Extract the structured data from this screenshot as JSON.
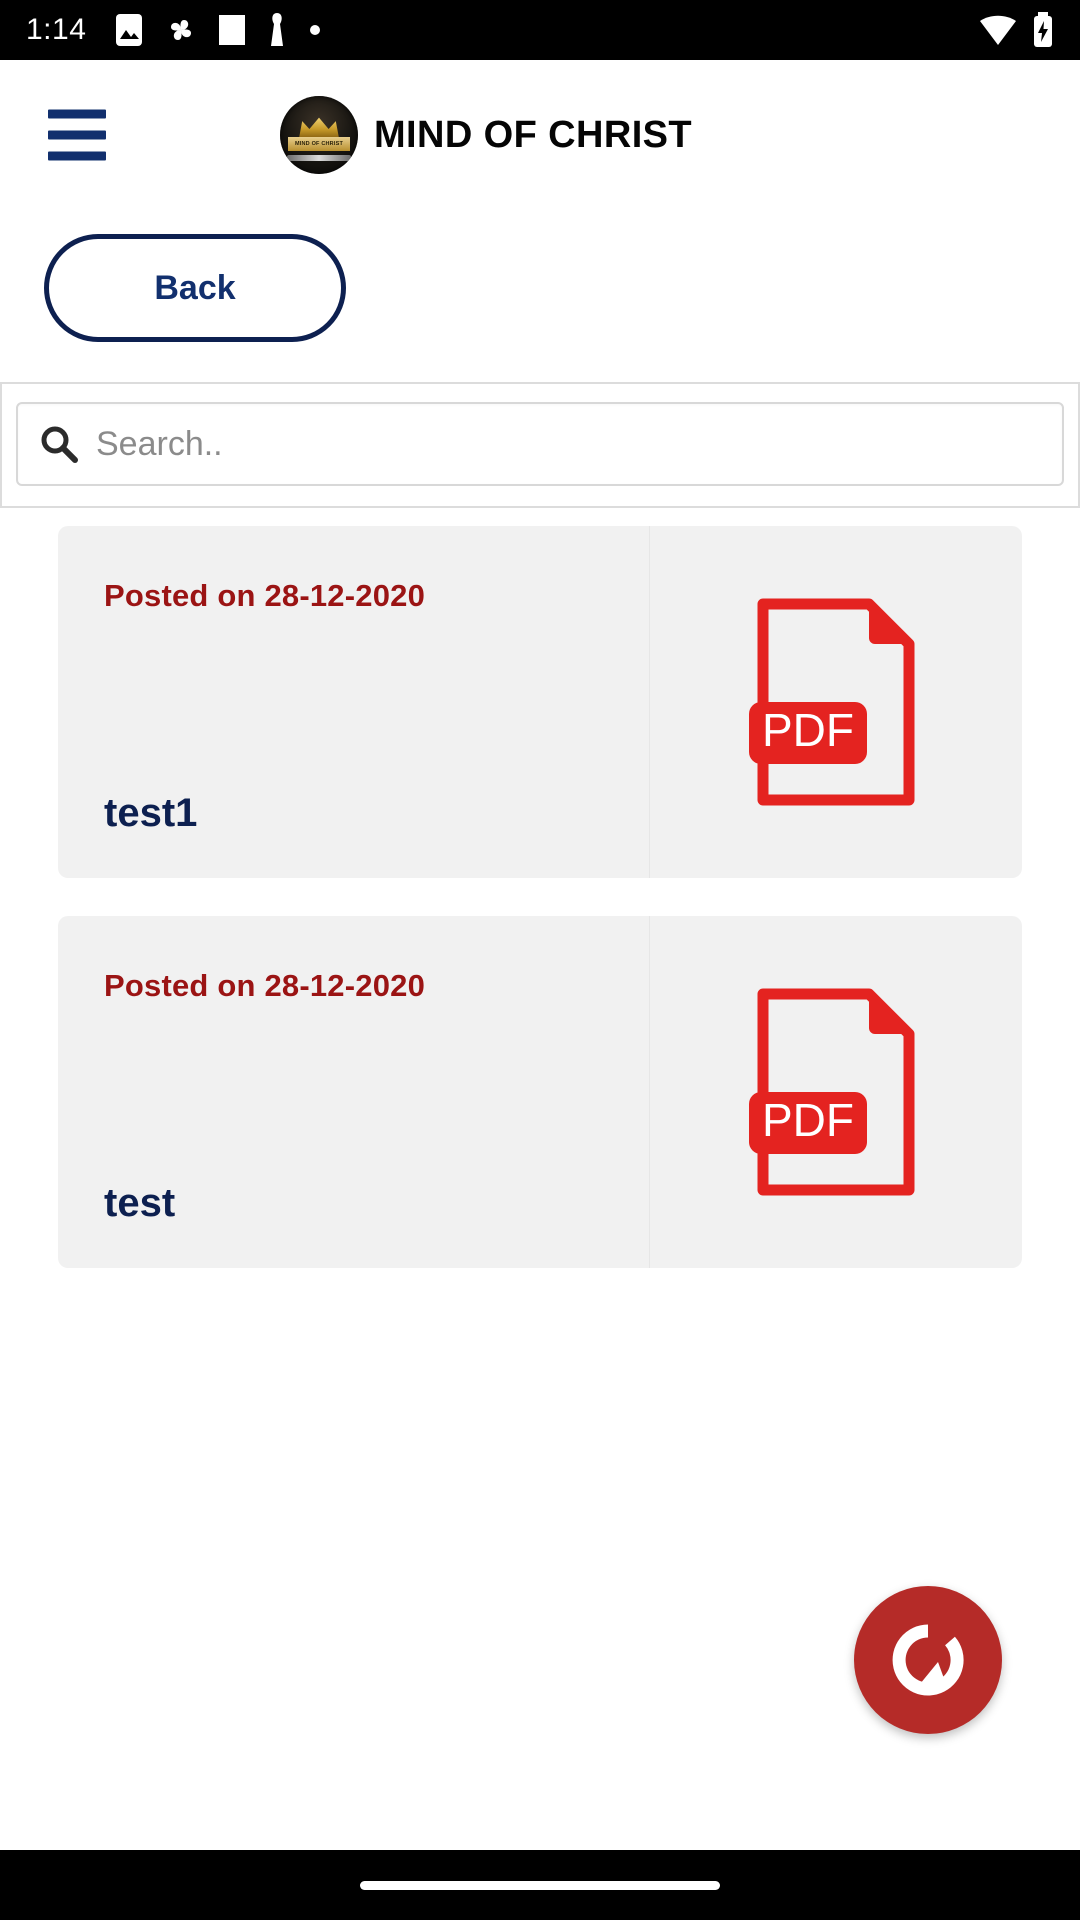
{
  "status_bar": {
    "time": "1:14",
    "left_icons": [
      "photo-icon",
      "pinwheel-icon",
      "square-icon",
      "key-icon",
      "dot-icon"
    ],
    "right_icons": [
      "wifi-icon",
      "battery-charging-icon"
    ]
  },
  "header": {
    "menu_icon": "hamburger-menu-icon",
    "logo_icon": "mind-of-christ-logo",
    "logo_banner_text": "MIND OF CHRIST",
    "title": "MIND OF CHRIST"
  },
  "back_button": {
    "label": "Back"
  },
  "search": {
    "icon": "search-icon",
    "value": "",
    "placeholder": "Search.."
  },
  "cards": [
    {
      "date": "Posted on 28-12-2020",
      "title": "test1",
      "file_icon": "pdf-file-icon",
      "file_label": "PDF"
    },
    {
      "date": "Posted on 28-12-2020",
      "title": "test",
      "file_icon": "pdf-file-icon",
      "file_label": "PDF"
    }
  ],
  "fab": {
    "icon": "refresh-icon",
    "label": ""
  },
  "colors": {
    "accent_navy": "#0d2050",
    "brand_navy": "#12306e",
    "date_red": "#9b1414",
    "pdf_red": "#e42320",
    "fab_red": "#b52b28",
    "card_bg": "#f1f1f1"
  },
  "nav_bar": {
    "handle": "home-gesture-pill"
  }
}
